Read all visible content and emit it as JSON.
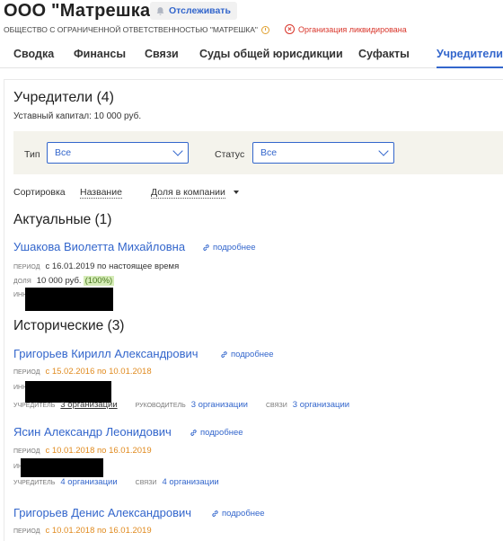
{
  "header": {
    "org_title": "ООО \"Матрешка\"",
    "follow_label": "Отслеживать",
    "org_full_name": "ОБЩЕСТВО С ОГРАНИЧЕННОЙ ОТВЕТСТВЕННОСТЬЮ \"МАТРЕШКА\"",
    "liquidated": "Организация ликвидирована"
  },
  "tabs": [
    {
      "label": "Сводка"
    },
    {
      "label": "Финансы"
    },
    {
      "label": "Связи"
    },
    {
      "label": "Суды общей юрисдикции"
    },
    {
      "label": "Суфакты"
    },
    {
      "label": "Учредители",
      "active": true
    }
  ],
  "founders": {
    "title": "Учредители (4)",
    "capital": "Уставный капитал: 10 000 руб."
  },
  "filters": {
    "type_label": "Тип",
    "type_value": "Все",
    "status_label": "Статус",
    "status_value": "Все"
  },
  "sort": {
    "label": "Сортировка",
    "by_name": "Название",
    "by_share": "Доля в компании"
  },
  "actual": {
    "title": "Актуальные (1)",
    "persons": [
      {
        "name": "Ушакова Виолетта Михайловна",
        "more": "подробнее",
        "period_label": "период",
        "period": "с 16.01.2019 по настоящее время",
        "share_label": "доля",
        "share": "10 000 руб.",
        "share_pct": "(100%)",
        "inn_label": "инн"
      }
    ]
  },
  "historic": {
    "title": "Исторические (3)",
    "persons": [
      {
        "name": "Григорьев Кирилл Александрович",
        "more": "подробнее",
        "period_label": "период",
        "period": "с 15.02.2016 по 10.01.2018",
        "inn_label": "инн",
        "founder_label": "учредитель",
        "founder_value": "3 организации",
        "head_label": "руководитель",
        "head_value": "3 организации",
        "links_label": "связи",
        "links_value": "3 организации"
      },
      {
        "name": "Ясин Александр Леонидович",
        "more": "подробнее",
        "period_label": "период",
        "period": "с 10.01.2018 по 16.01.2019",
        "inn_label": "инн",
        "founder_label": "учредитель",
        "founder_value": "4 организации",
        "links_label": "связи",
        "links_value": "4 организации"
      },
      {
        "name": "Григорьев Денис Александрович",
        "more": "подробнее",
        "period_label": "период",
        "period": "с 10.01.2018 по 16.01.2019"
      }
    ]
  },
  "colors": {
    "accent": "#3366cc",
    "warning": "#e08a1e",
    "danger": "#d9362b",
    "share_bg": "#d6ecb8",
    "filter_bg": "#f4f3ec"
  },
  "icons": {
    "follow": "bell-icon",
    "status": "clock-icon",
    "liquidated": "x-circle-icon",
    "more": "link-icon",
    "select": "chevron-down-icon"
  }
}
